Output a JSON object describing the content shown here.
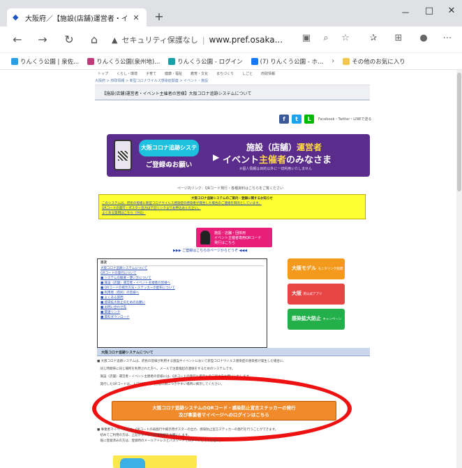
{
  "browser": {
    "tab_title": "大阪府／【施設(店舗)運営者・イ",
    "new_tab": "+",
    "controls": {
      "minimize": "－",
      "maximize": "□",
      "close": "✕"
    },
    "security_label": "セキュリティ保護なし",
    "url": "www.pref.osaka..."
  },
  "favorites": [
    {
      "label": "りんくう公園 | 泉佐...",
      "color": "#2aa0e0"
    },
    {
      "label": "りんくう公園(泉州地)...",
      "color": "#c03a7a"
    },
    {
      "label": "りんくう公園 - ログイン",
      "color": "#18a0a8"
    },
    {
      "label": "(7) りんくう公園 - ホ...",
      "color": "#1877f2"
    }
  ],
  "favorites_folder": "その他のお気に入り",
  "page": {
    "site_nav": [
      "トップ",
      "くらし・環境",
      "子育て",
      "健康・福祉",
      "教育・文化",
      "まちづくり",
      "しごと",
      "府政情報"
    ],
    "breadcrumb": "大阪府 > 府政情報 > 新型コロナウイルス感染症関連 > イベント・施設",
    "title": "【施設(店舗)運営者・イベント主催者の皆様】大阪コロナ追跡システムについて",
    "share_text": "Facebook・Twitter・LINEで送る",
    "banner": {
      "logo": "大阪コロナ追跡システム",
      "ask": "ご登録のお願い",
      "line1_a": "施設（店舗）",
      "line1_b": "運営者",
      "line2_a": "イベント",
      "line2_b": "主催者",
      "line2_c": "のみなさま",
      "note": "※個人情報は目的以外に一切利用いたしません"
    },
    "small_link": "ページ内リンク：QRコード発行・各種資料はこちらをご覧ください",
    "yellow": {
      "title": "大阪コロナ追跡システムのご案内・登録に関するお知らせ",
      "lines": [
        "このシステムは、府民の皆様に新型コロナウイルス感染症の感染者が発生した場合のご連絡を目的としています。",
        "QRコードの発行・ポスター出力は下記リンクよりお申込みください。",
        "よくある質問はこちら（FAQ）"
      ]
    },
    "pink_button": {
      "line1": "施設・店舗・団体用",
      "line2": "イベント主催者専用QRコード",
      "line3": "発行はこちら"
    },
    "link_row": "▶▶▶ ご登録はこちらのページからどうぞ ◀◀◀",
    "toc": {
      "heading": "目次",
      "items": [
        "大阪コロナ追跡システムについて",
        "QRコードの発行について",
        "■ システムの概要・使い方について",
        "■ 施設（店舗）運営者・イベント主催者の皆様へ",
        "■ QRコードの掲示方法・ステッカーの配布について",
        "■ 利用者（府民）の皆様へ",
        "■ よくある質問",
        "■ 感染拡大防止のためのお願い",
        "■ お問い合わせ先",
        "■ 関連リンク",
        "■ 資料ダウンロード"
      ]
    },
    "side_buttons": [
      {
        "label": "大阪モデル",
        "sub": "モニタリング指標",
        "color": "#f39a1c"
      },
      {
        "label": "大阪",
        "sub": "府公式アプリ",
        "color": "#e84545"
      },
      {
        "label": "感染拡大防止",
        "sub": "キャンペーン",
        "color": "#23b04a"
      }
    ],
    "section_heading": "大阪コロナ追跡システムについて",
    "body": [
      "■ 大阪コロナ追跡システムは、府民の皆様が利用する施設やイベントにおいて新型コロナウイルス感染症の感染者が発生した場合に、",
      "　同じ時間帯に同じ場所を利用された方へ、メールで注意喚起の連絡をするためのシステムです。",
      "　施設（店舗）運営者・イベント主催者の皆様には、QRコードの発行と掲示へのご協力をお願いいたします。",
      "　発行したQRコードは、入口付近など利用者の目につきやすい場所に掲示してください。"
    ],
    "orange_button": {
      "line1": "大阪コロナ追跡システムのQRコード・感染防止宣言ステッカーの発行",
      "line2": "及び事業者マイページへのログインはこちら"
    },
    "footer": [
      "■ 事業者マイページでは、QRコードの再発行や掲示用ポスターの出力、感染防止宣言ステッカーの発行を行うことができます。",
      "　初めてご利用の方は、上記ボタンから新規登録をお願いします。",
      "　既に登録済みの方は、登録時のメールアドレスとパスワードでログインしてください。"
    ]
  }
}
